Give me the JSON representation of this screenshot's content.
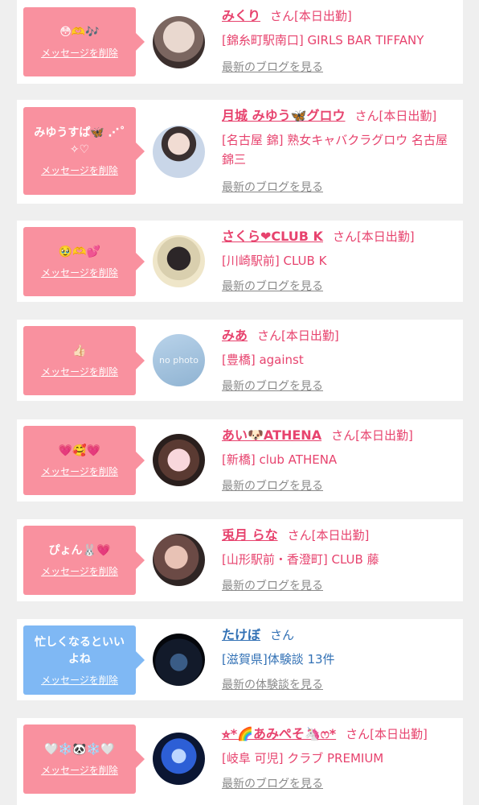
{
  "delete_label": "メッセージを削除",
  "blog_label": "最新のブログを見る",
  "review_label": "最新の体験談を見る",
  "san_label": "さん",
  "status_label": "[本日出勤]",
  "colors": {
    "pink_bubble": "#f9919f",
    "blue_bubble": "#7fb8f4",
    "pink_text": "#e7436e",
    "blue_text": "#3271b5"
  },
  "cards": [
    {
      "message": "😳🫶🎶",
      "name": "みくり",
      "status": "[本日出勤]",
      "store": "[錦糸町駅南口] GIRLS BAR TIFFANY",
      "link": "最新のブログを見る",
      "avatar": "person-photo"
    },
    {
      "message": "みゆうすぱ🦋 ⋰˚✧♡",
      "name": "月城 みゆう🦋グロウ",
      "status": "[本日出勤]",
      "store": "[名古屋 錦] 熟女キャバクラグロウ 名古屋錦三",
      "link": "最新のブログを見る",
      "avatar": "person-photo"
    },
    {
      "message": "🥹🫶💕",
      "name": "さくら❤CLUB K",
      "status": "[本日出勤]",
      "store": "[川崎駅前] CLUB K",
      "link": "最新のブログを見る",
      "avatar": "person-photo"
    },
    {
      "message": "👍🏻",
      "name": "みあ",
      "status": "[本日出勤]",
      "store": "[豊橋] against",
      "link": "最新のブログを見る",
      "avatar": "no-photo-placeholder",
      "avatar_text": "no photo"
    },
    {
      "message": "💗🥰💗",
      "name": "あい🐶ATHENA",
      "status": "[本日出勤]",
      "store": "[新橋] club ATHENA",
      "link": "最新のブログを見る",
      "avatar": "person-photo"
    },
    {
      "message": "ぴょん🐰💗",
      "name": "兎月 らな",
      "status": "[本日出勤]",
      "store": "[山形駅前・香澄町] CLUB 藤",
      "link": "最新のブログを見る",
      "avatar": "person-photo"
    },
    {
      "message": "忙しくなるといいよね",
      "name": "たけぼ",
      "status": "",
      "store": "[滋賀県]体験談 13件",
      "link": "最新の体験談を見る",
      "avatar": "person-photo",
      "variant": "blue"
    },
    {
      "message": "🤍❄️🐼❄️🤍",
      "name": "⭐︎*🌈あみぺそ🦄ෆ*",
      "status": "[本日出勤]",
      "store": "[岐阜 可児] クラブ PREMIUM",
      "link": "最新のブログを見る",
      "avatar": "person-photo"
    }
  ]
}
